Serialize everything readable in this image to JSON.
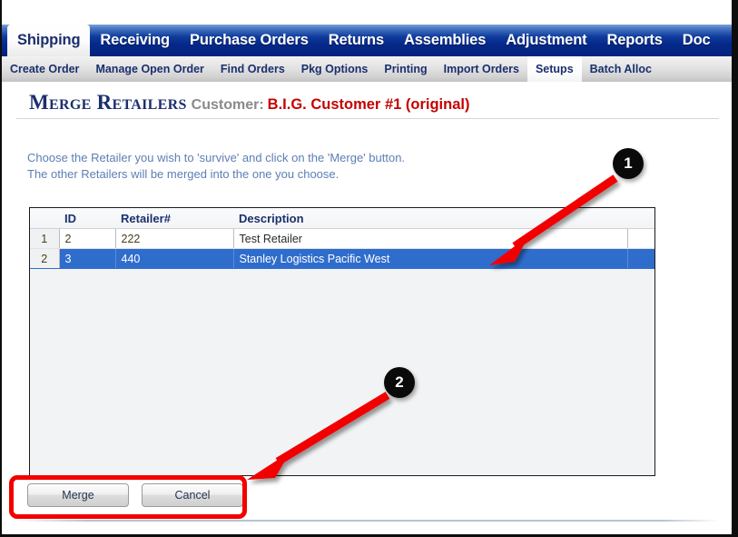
{
  "window": {
    "frame_color": "#0d0d0d"
  },
  "main_tabs": [
    {
      "label": "Shipping",
      "active": true
    },
    {
      "label": "Receiving",
      "active": false
    },
    {
      "label": "Purchase Orders",
      "active": false
    },
    {
      "label": "Returns",
      "active": false
    },
    {
      "label": "Assemblies",
      "active": false
    },
    {
      "label": "Adjustment",
      "active": false
    },
    {
      "label": "Reports",
      "active": false
    },
    {
      "label": "Doc",
      "active": false
    }
  ],
  "sub_tabs": [
    {
      "label": "Create Order",
      "active": false
    },
    {
      "label": "Manage Open Order",
      "active": false
    },
    {
      "label": "Find Orders",
      "active": false
    },
    {
      "label": "Pkg Options",
      "active": false
    },
    {
      "label": "Printing",
      "active": false
    },
    {
      "label": "Import Orders",
      "active": false
    },
    {
      "label": "Setups",
      "active": true
    },
    {
      "label": "Batch Alloc",
      "active": false
    }
  ],
  "heading": {
    "title": "Merge Retailers",
    "customer_label": "Customer:",
    "customer_name": "B.I.G. Customer #1 (original)",
    "title_color": "#1b2f6e",
    "customer_label_color": "#8a8a8a",
    "customer_name_color": "#c60000"
  },
  "instructions": {
    "line1": "Choose the Retailer you wish to 'survive' and click on the 'Merge' button.",
    "line2": "The other Retailers will be merged into the one you choose.",
    "color": "#5b7fb5"
  },
  "grid": {
    "columns": [
      "",
      "ID",
      "Retailer#",
      "Description",
      ""
    ],
    "rows": [
      {
        "rownum": "1",
        "id": "2",
        "retailer": "222",
        "description": "Test Retailer",
        "selected": false
      },
      {
        "rownum": "2",
        "id": "3",
        "retailer": "440",
        "description": "Stanley Logistics Pacific West",
        "selected": true
      }
    ],
    "selection_color": "#2f6dcd"
  },
  "buttons": {
    "merge_label": "Merge",
    "cancel_label": "Cancel"
  },
  "annotations": {
    "badge_1": "1",
    "badge_2": "2",
    "arrow_color": "#f20000",
    "badge_color": "#0a0a0a",
    "highlight_box_color": "#f20000"
  }
}
